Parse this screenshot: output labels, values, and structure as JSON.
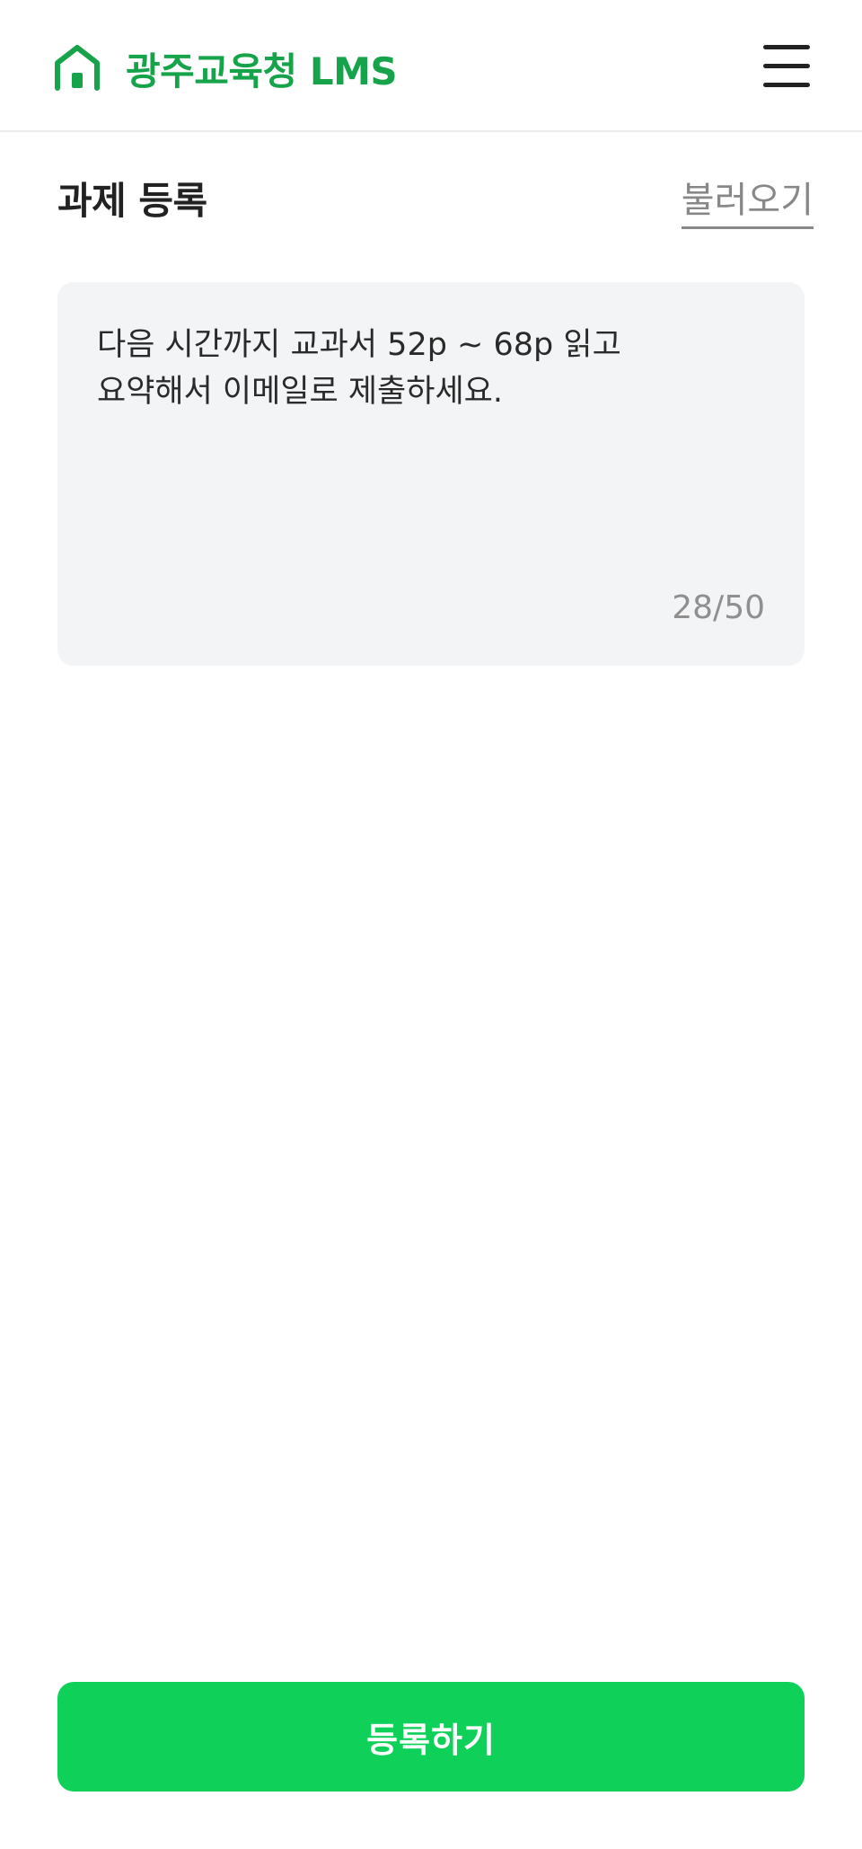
{
  "header": {
    "app_title": "광주교육청 LMS",
    "logo_icon": "home-icon",
    "menu_icon": "hamburger-menu-icon",
    "accent_color": "#16a34a"
  },
  "main": {
    "section_title": "과제 등록",
    "load_link": "불러오기",
    "assignment": {
      "text": "다음 시간까지 교과서 52p ~ 68p 읽고\n요약해서 이메일로 제출하세요.",
      "char_count": "28/50"
    }
  },
  "footer": {
    "submit_label": "등록하기",
    "submit_color": "#0fd15a"
  }
}
